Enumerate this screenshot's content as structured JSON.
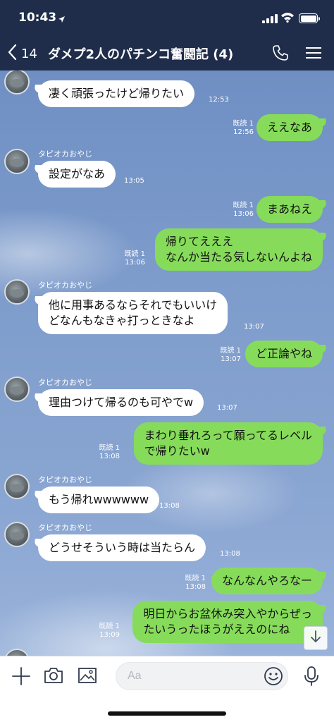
{
  "status_bar": {
    "time": "10:43"
  },
  "header": {
    "back_count": "14",
    "title": "ダメプ2人のパチンコ奮闘記 (4)"
  },
  "colors": {
    "header_bg": "#1f2d4a",
    "outgoing_bubble": "#86dc5a",
    "incoming_bubble": "#ffffff"
  },
  "messages": [
    {
      "direction": "in",
      "sender": "",
      "text": "凄く頑張ったけど帰りたい",
      "time": "12:53"
    },
    {
      "direction": "out",
      "read": "既読 1",
      "text": "ええなあ",
      "time": "12:56"
    },
    {
      "direction": "in",
      "sender": "タピオカおやじ",
      "text": "設定がなあ",
      "time": "13:05"
    },
    {
      "direction": "out",
      "read": "既読 1",
      "text": "まあねえ",
      "time": "13:06"
    },
    {
      "direction": "out",
      "read": "既読 1",
      "text_lines": [
        "帰りてえええ",
        "なんか当たる気しないんよね"
      ],
      "time": "13:06"
    },
    {
      "direction": "in",
      "sender": "タピオカおやじ",
      "text_lines": [
        "他に用事あるならそれでもいいけ",
        "どなんもなきゃ打っときなよ"
      ],
      "time": "13:07"
    },
    {
      "direction": "out",
      "read": "既読 1",
      "text": "ど正論やね",
      "time": "13:07"
    },
    {
      "direction": "in",
      "sender": "タピオカおやじ",
      "text": "理由つけて帰るのも可やでw",
      "time": "13:07"
    },
    {
      "direction": "out",
      "read": "既読 1",
      "text_lines": [
        "まわり垂れろって願ってるレベル",
        "で帰りたいw"
      ],
      "time": "13:08"
    },
    {
      "direction": "in",
      "sender": "タピオカおやじ",
      "text": "もう帰れwwwwww",
      "time": "13:08"
    },
    {
      "direction": "in",
      "sender": "タピオカおやじ",
      "text": "どうせそういう時は当たらん",
      "time": "13:08"
    },
    {
      "direction": "out",
      "read": "既読 1",
      "text": "なんなんやろなー",
      "time": "13:08"
    },
    {
      "direction": "out",
      "read": "既読 1",
      "text_lines": [
        "明日からお盆休み突入やからぜっ",
        "たいうったほうがええのにね"
      ],
      "time": "13:09"
    }
  ],
  "input": {
    "placeholder": "Aa"
  },
  "icons": [
    "location-arrow-icon",
    "signal-icon",
    "wifi-icon",
    "battery-icon",
    "back-chevron-icon",
    "phone-icon",
    "menu-icon",
    "plus-icon",
    "camera-icon",
    "image-icon",
    "emoji-icon",
    "mic-icon",
    "scroll-down-icon"
  ]
}
